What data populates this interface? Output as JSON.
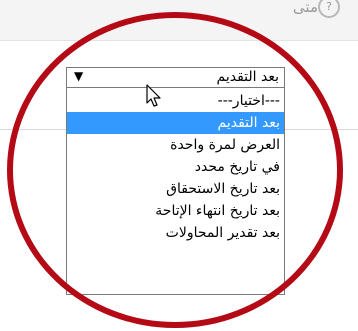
{
  "header": {
    "label": "متى",
    "help_icon": "?"
  },
  "select": {
    "current_value": "بعد التقديم",
    "arrow_icon": "▼",
    "options": [
      "---اختيار---",
      "بعد التقديم",
      "العرض لمرة واحدة",
      "في تاريخ محدد",
      "بعد تاريخ الاستحقاق",
      "بعد تاريخ انتهاء الإتاحة",
      "بعد تقدير المحاولات"
    ],
    "selected_index": 1
  },
  "colors": {
    "highlight": "#3399ff",
    "annotation_ring": "#b40a16"
  },
  "icons": {
    "cursor": "mouse-pointer-icon",
    "help": "question-circle-icon",
    "dropdown": "triangle-down-icon"
  }
}
